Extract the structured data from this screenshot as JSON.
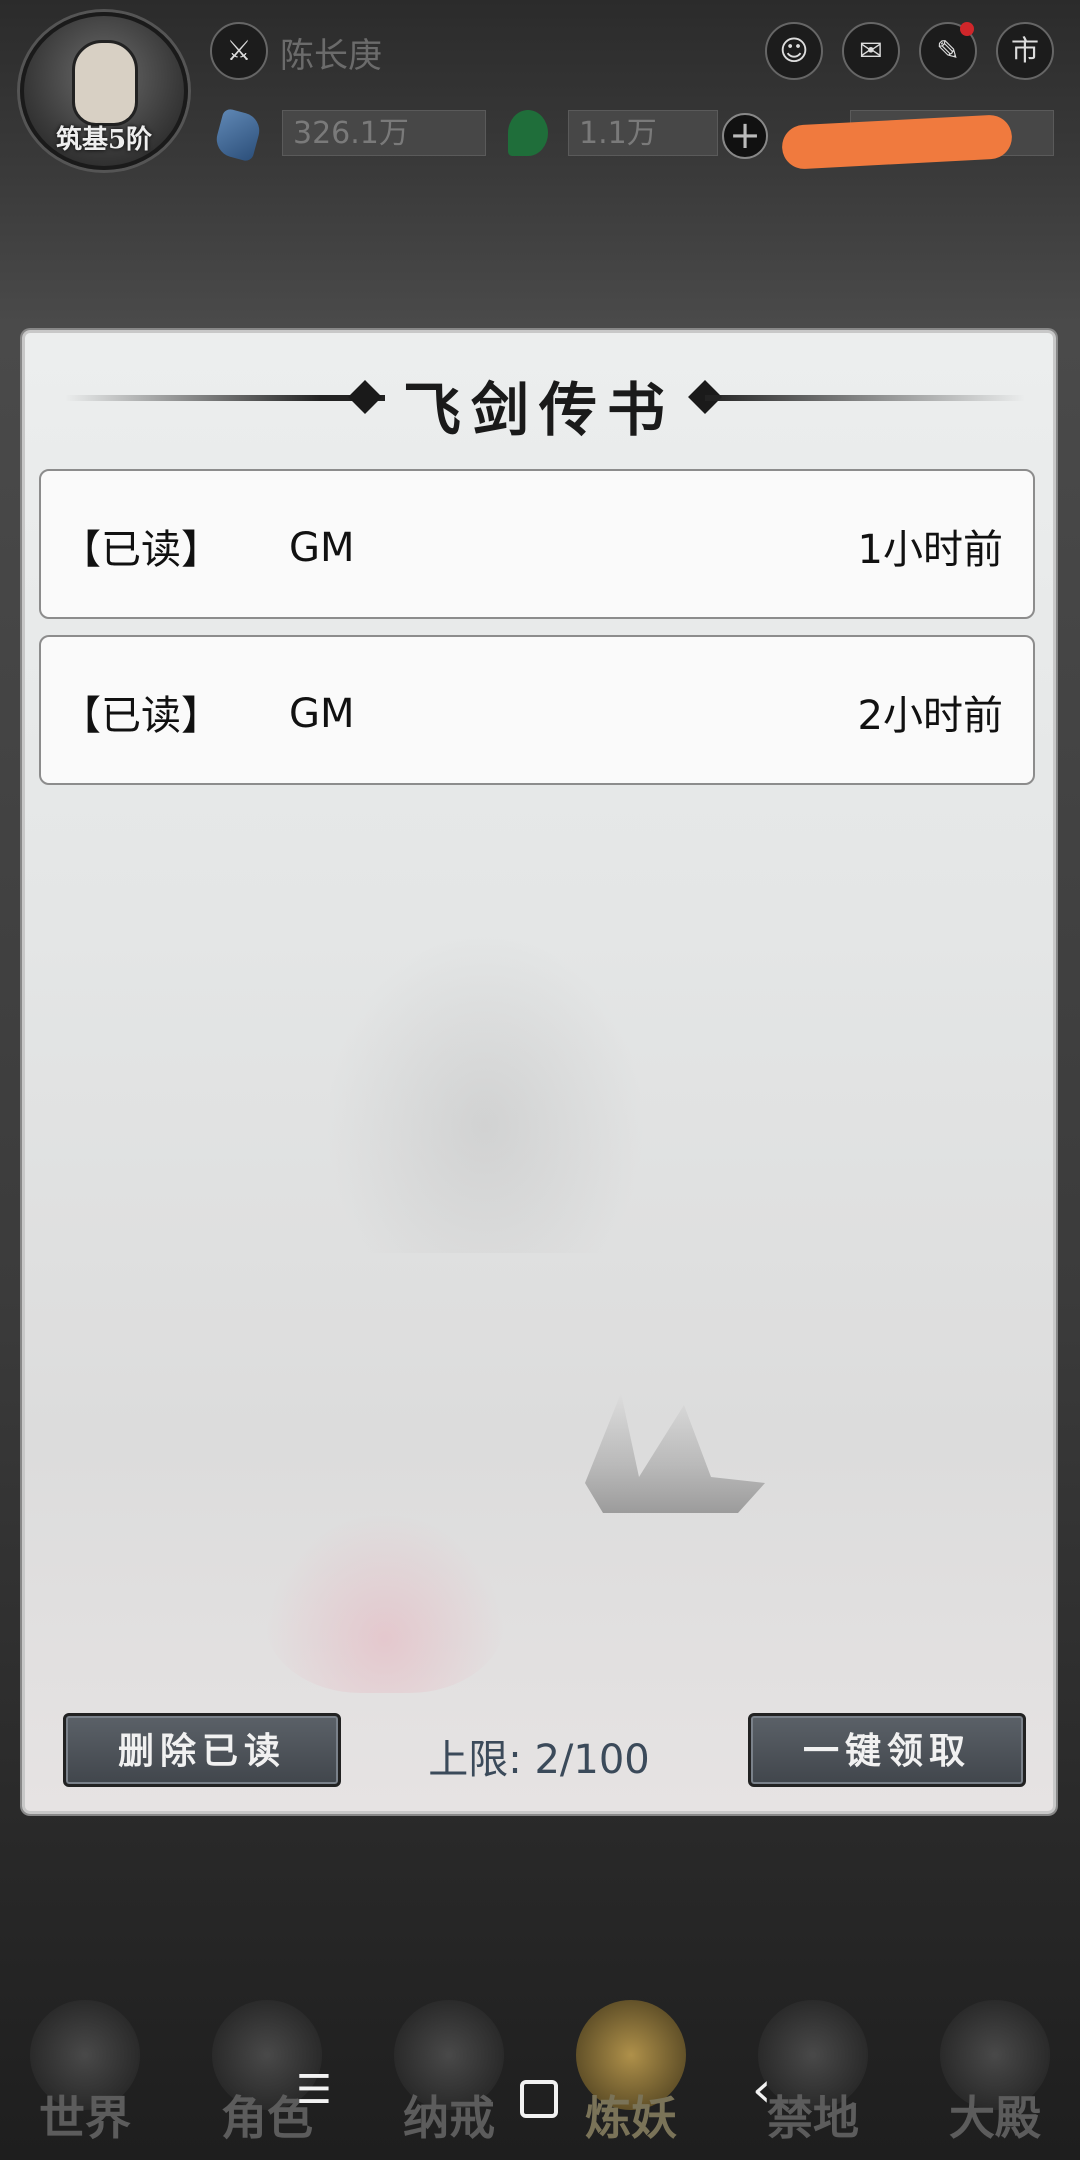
{
  "header": {
    "player_name": "陈长庚",
    "rank_badge": "筑基5阶",
    "resource_1": "326.1万",
    "resource_2": "1.1万",
    "plus_label": "+",
    "shop_label": "市"
  },
  "panel": {
    "title": "飞剑传书",
    "mails": [
      {
        "status": "【已读】",
        "sender": "GM",
        "time": "1小时前"
      },
      {
        "status": "【已读】",
        "sender": "GM",
        "time": "2小时前"
      }
    ],
    "delete_read_label": "删除已读",
    "limit_text": "上限: 2/100",
    "claim_all_label": "一键领取"
  },
  "bottom_nav": {
    "items": [
      {
        "label": "世界",
        "icon": "world-icon"
      },
      {
        "label": "角色",
        "icon": "character-icon"
      },
      {
        "label": "纳戒",
        "icon": "ring-icon"
      },
      {
        "label": "炼妖",
        "icon": "refine-demon-icon",
        "active": true
      },
      {
        "label": "禁地",
        "icon": "forbidden-land-icon"
      },
      {
        "label": "大殿",
        "icon": "hall-icon"
      }
    ]
  },
  "system_nav": {
    "menu_glyph": "☰",
    "back_glyph": "‹"
  },
  "colors": {
    "panel_bg": "#e6e8e8",
    "button_bg": "#4f555b",
    "limit_text": "#3b4a5a",
    "redaction": "#f07a3e",
    "notification_dot": "#d0262a"
  }
}
